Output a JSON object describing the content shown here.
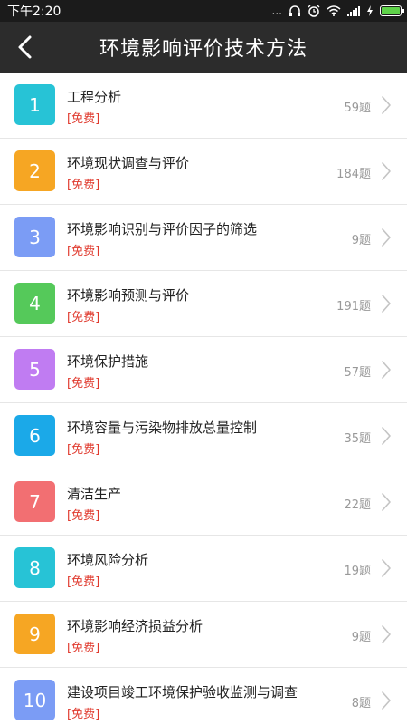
{
  "status_bar": {
    "time": "下午2:20",
    "dots": "...",
    "icons": [
      "headset-icon",
      "alarm-icon",
      "wifi-icon",
      "signal-icon",
      "charging-icon",
      "battery-icon"
    ],
    "battery_color": "#5fd34a"
  },
  "header": {
    "title": "环境影响评价技术方法",
    "back_icon": "chevron-left-icon"
  },
  "list": [
    {
      "number": "1",
      "title": "工程分析",
      "tag": "[免费]",
      "count": "59题",
      "color": "#27c3d6"
    },
    {
      "number": "2",
      "title": "环境现状调查与评价",
      "tag": "[免费]",
      "count": "184题",
      "color": "#f6a623"
    },
    {
      "number": "3",
      "title": "环境影响识别与评价因子的筛选",
      "tag": "[免费]",
      "count": "9题",
      "color": "#7b9cf5"
    },
    {
      "number": "4",
      "title": "环境影响预测与评价",
      "tag": "[免费]",
      "count": "191题",
      "color": "#55c95a"
    },
    {
      "number": "5",
      "title": "环境保护措施",
      "tag": "[免费]",
      "count": "57题",
      "color": "#c07cf2"
    },
    {
      "number": "6",
      "title": "环境容量与污染物排放总量控制",
      "tag": "[免费]",
      "count": "35题",
      "color": "#1ba9e8"
    },
    {
      "number": "7",
      "title": "清洁生产",
      "tag": "[免费]",
      "count": "22题",
      "color": "#f26f72"
    },
    {
      "number": "8",
      "title": "环境风险分析",
      "tag": "[免费]",
      "count": "19题",
      "color": "#27c3d6"
    },
    {
      "number": "9",
      "title": "环境影响经济损益分析",
      "tag": "[免费]",
      "count": "9题",
      "color": "#f6a623"
    },
    {
      "number": "10",
      "title": "建设项目竣工环境保护验收监测与调查",
      "tag": "[免费]",
      "count": "8题",
      "color": "#7b9cf5"
    }
  ]
}
